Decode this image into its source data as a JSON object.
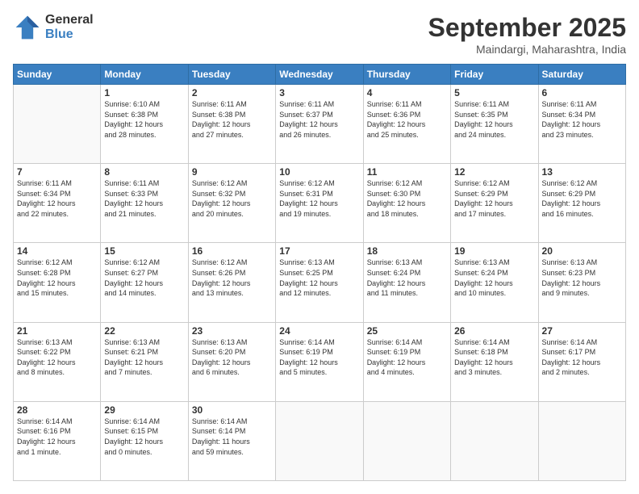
{
  "logo": {
    "general": "General",
    "blue": "Blue"
  },
  "header": {
    "month": "September 2025",
    "location": "Maindargi, Maharashtra, India"
  },
  "weekdays": [
    "Sunday",
    "Monday",
    "Tuesday",
    "Wednesday",
    "Thursday",
    "Friday",
    "Saturday"
  ],
  "weeks": [
    [
      {
        "day": "",
        "info": ""
      },
      {
        "day": "1",
        "info": "Sunrise: 6:10 AM\nSunset: 6:38 PM\nDaylight: 12 hours\nand 28 minutes."
      },
      {
        "day": "2",
        "info": "Sunrise: 6:11 AM\nSunset: 6:38 PM\nDaylight: 12 hours\nand 27 minutes."
      },
      {
        "day": "3",
        "info": "Sunrise: 6:11 AM\nSunset: 6:37 PM\nDaylight: 12 hours\nand 26 minutes."
      },
      {
        "day": "4",
        "info": "Sunrise: 6:11 AM\nSunset: 6:36 PM\nDaylight: 12 hours\nand 25 minutes."
      },
      {
        "day": "5",
        "info": "Sunrise: 6:11 AM\nSunset: 6:35 PM\nDaylight: 12 hours\nand 24 minutes."
      },
      {
        "day": "6",
        "info": "Sunrise: 6:11 AM\nSunset: 6:34 PM\nDaylight: 12 hours\nand 23 minutes."
      }
    ],
    [
      {
        "day": "7",
        "info": "Sunrise: 6:11 AM\nSunset: 6:34 PM\nDaylight: 12 hours\nand 22 minutes."
      },
      {
        "day": "8",
        "info": "Sunrise: 6:11 AM\nSunset: 6:33 PM\nDaylight: 12 hours\nand 21 minutes."
      },
      {
        "day": "9",
        "info": "Sunrise: 6:12 AM\nSunset: 6:32 PM\nDaylight: 12 hours\nand 20 minutes."
      },
      {
        "day": "10",
        "info": "Sunrise: 6:12 AM\nSunset: 6:31 PM\nDaylight: 12 hours\nand 19 minutes."
      },
      {
        "day": "11",
        "info": "Sunrise: 6:12 AM\nSunset: 6:30 PM\nDaylight: 12 hours\nand 18 minutes."
      },
      {
        "day": "12",
        "info": "Sunrise: 6:12 AM\nSunset: 6:29 PM\nDaylight: 12 hours\nand 17 minutes."
      },
      {
        "day": "13",
        "info": "Sunrise: 6:12 AM\nSunset: 6:29 PM\nDaylight: 12 hours\nand 16 minutes."
      }
    ],
    [
      {
        "day": "14",
        "info": "Sunrise: 6:12 AM\nSunset: 6:28 PM\nDaylight: 12 hours\nand 15 minutes."
      },
      {
        "day": "15",
        "info": "Sunrise: 6:12 AM\nSunset: 6:27 PM\nDaylight: 12 hours\nand 14 minutes."
      },
      {
        "day": "16",
        "info": "Sunrise: 6:12 AM\nSunset: 6:26 PM\nDaylight: 12 hours\nand 13 minutes."
      },
      {
        "day": "17",
        "info": "Sunrise: 6:13 AM\nSunset: 6:25 PM\nDaylight: 12 hours\nand 12 minutes."
      },
      {
        "day": "18",
        "info": "Sunrise: 6:13 AM\nSunset: 6:24 PM\nDaylight: 12 hours\nand 11 minutes."
      },
      {
        "day": "19",
        "info": "Sunrise: 6:13 AM\nSunset: 6:24 PM\nDaylight: 12 hours\nand 10 minutes."
      },
      {
        "day": "20",
        "info": "Sunrise: 6:13 AM\nSunset: 6:23 PM\nDaylight: 12 hours\nand 9 minutes."
      }
    ],
    [
      {
        "day": "21",
        "info": "Sunrise: 6:13 AM\nSunset: 6:22 PM\nDaylight: 12 hours\nand 8 minutes."
      },
      {
        "day": "22",
        "info": "Sunrise: 6:13 AM\nSunset: 6:21 PM\nDaylight: 12 hours\nand 7 minutes."
      },
      {
        "day": "23",
        "info": "Sunrise: 6:13 AM\nSunset: 6:20 PM\nDaylight: 12 hours\nand 6 minutes."
      },
      {
        "day": "24",
        "info": "Sunrise: 6:14 AM\nSunset: 6:19 PM\nDaylight: 12 hours\nand 5 minutes."
      },
      {
        "day": "25",
        "info": "Sunrise: 6:14 AM\nSunset: 6:19 PM\nDaylight: 12 hours\nand 4 minutes."
      },
      {
        "day": "26",
        "info": "Sunrise: 6:14 AM\nSunset: 6:18 PM\nDaylight: 12 hours\nand 3 minutes."
      },
      {
        "day": "27",
        "info": "Sunrise: 6:14 AM\nSunset: 6:17 PM\nDaylight: 12 hours\nand 2 minutes."
      }
    ],
    [
      {
        "day": "28",
        "info": "Sunrise: 6:14 AM\nSunset: 6:16 PM\nDaylight: 12 hours\nand 1 minute."
      },
      {
        "day": "29",
        "info": "Sunrise: 6:14 AM\nSunset: 6:15 PM\nDaylight: 12 hours\nand 0 minutes."
      },
      {
        "day": "30",
        "info": "Sunrise: 6:14 AM\nSunset: 6:14 PM\nDaylight: 11 hours\nand 59 minutes."
      },
      {
        "day": "",
        "info": ""
      },
      {
        "day": "",
        "info": ""
      },
      {
        "day": "",
        "info": ""
      },
      {
        "day": "",
        "info": ""
      }
    ]
  ]
}
